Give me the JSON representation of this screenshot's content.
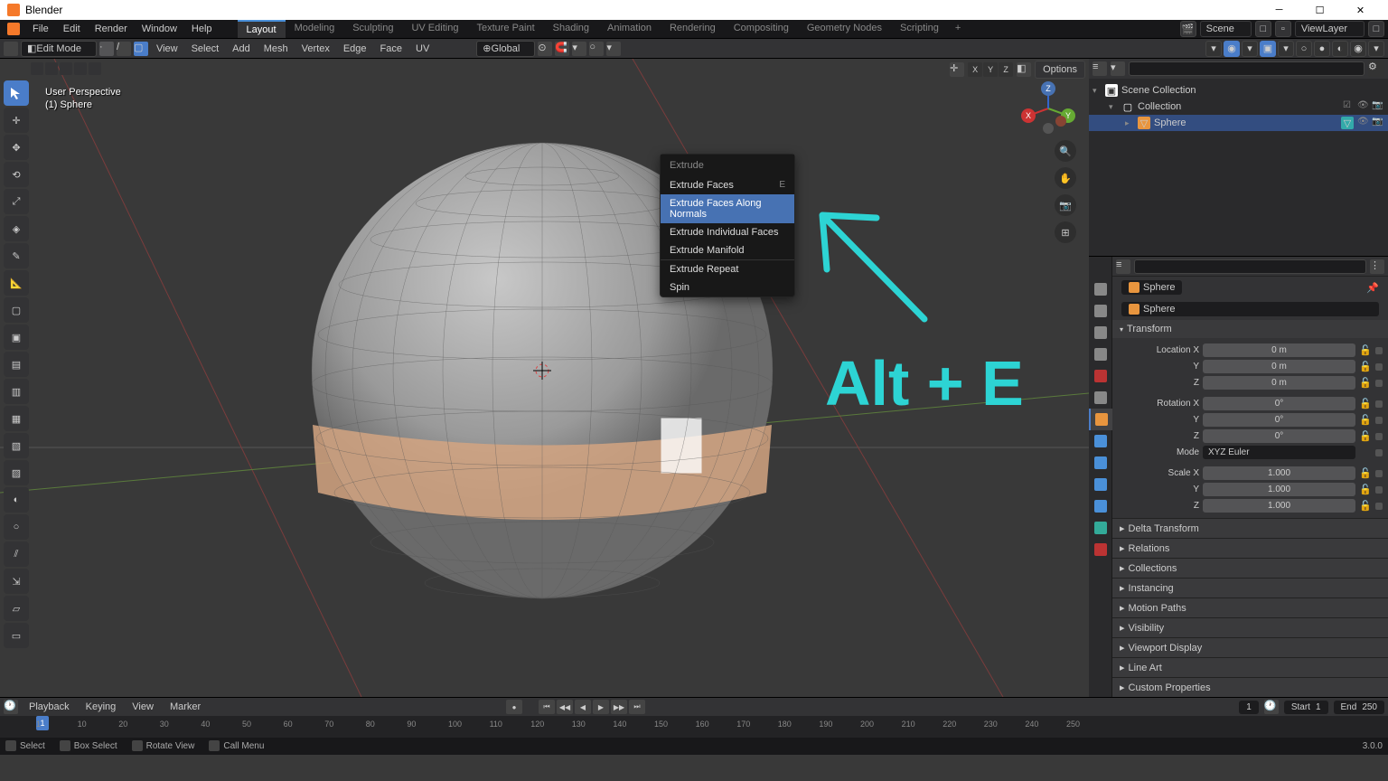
{
  "app": {
    "title": "Blender"
  },
  "menubar": {
    "items": [
      "File",
      "Edit",
      "Render",
      "Window",
      "Help"
    ]
  },
  "workspaces": {
    "tabs": [
      "Layout",
      "Modeling",
      "Sculpting",
      "UV Editing",
      "Texture Paint",
      "Shading",
      "Animation",
      "Rendering",
      "Compositing",
      "Geometry Nodes",
      "Scripting"
    ],
    "active": "Layout"
  },
  "scene": {
    "name": "Scene",
    "view_layer": "ViewLayer"
  },
  "toolbar": {
    "mode": "Edit Mode",
    "menus": [
      "View",
      "Select",
      "Add",
      "Mesh",
      "Vertex",
      "Edge",
      "Face",
      "UV"
    ],
    "orientation": "Global",
    "options_label": "Options"
  },
  "viewport": {
    "perspective": "User Perspective",
    "object_context": "(1) Sphere",
    "axis_labels": [
      "X",
      "Y",
      "Z"
    ]
  },
  "context_menu": {
    "title": "Extrude",
    "items": [
      {
        "label": "Extrude Faces",
        "shortcut": "E"
      },
      {
        "label": "Extrude Faces Along Normals",
        "highlighted": true
      },
      {
        "label": "Extrude Individual Faces"
      },
      {
        "label": "Extrude Manifold"
      },
      {
        "label": "Extrude Repeat",
        "divider": true
      },
      {
        "label": "Spin"
      }
    ]
  },
  "annotation": {
    "text": "Alt + E"
  },
  "outliner": {
    "root": "Scene Collection",
    "collection": "Collection",
    "items": [
      {
        "name": "Sphere"
      }
    ]
  },
  "properties": {
    "breadcrumb1": "Sphere",
    "breadcrumb2": "Sphere",
    "panels": {
      "transform": {
        "title": "Transform",
        "location_label": "Location X",
        "location_x": "0 m",
        "location_y": "0 m",
        "location_z": "0 m",
        "y_label": "Y",
        "z_label": "Z",
        "rotation_label": "Rotation X",
        "rotation_x": "0°",
        "rotation_y": "0°",
        "rotation_z": "0°",
        "mode_label": "Mode",
        "mode": "XYZ Euler",
        "scale_label": "Scale X",
        "scale_x": "1.000",
        "scale_y": "1.000",
        "scale_z": "1.000"
      },
      "collapsed": [
        "Delta Transform",
        "Relations",
        "Collections",
        "Instancing",
        "Motion Paths",
        "Visibility",
        "Viewport Display",
        "Line Art",
        "Custom Properties"
      ]
    }
  },
  "timeline": {
    "menus": [
      "Playback",
      "Keying",
      "View",
      "Marker"
    ],
    "current": "1",
    "start_label": "Start",
    "start": "1",
    "end_label": "End",
    "end": "250",
    "marks": [
      1,
      10,
      20,
      30,
      40,
      50,
      60,
      70,
      80,
      90,
      100,
      110,
      120,
      130,
      140,
      150,
      160,
      170,
      180,
      190,
      200,
      210,
      220,
      230,
      240,
      250
    ]
  },
  "statusbar": {
    "select": "Select",
    "box_select": "Box Select",
    "rotate_view": "Rotate View",
    "call_menu": "Call Menu",
    "version": "3.0.0"
  }
}
